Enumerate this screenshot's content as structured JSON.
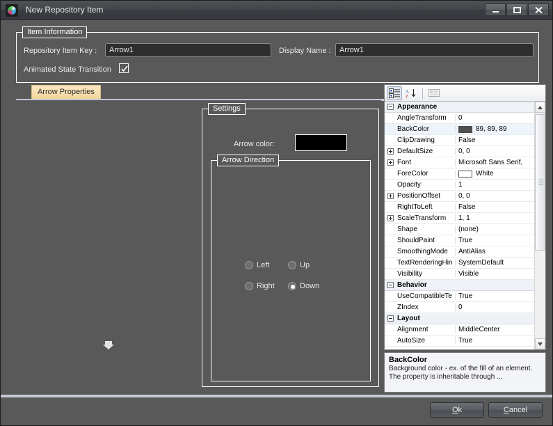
{
  "window": {
    "title": "New Repository Item",
    "app_icon": "color-orb-icon",
    "controls": {
      "minimize": "minimize-icon",
      "maximize": "maximize-icon",
      "close": "close-icon"
    }
  },
  "item_information": {
    "group_title": "Item Information",
    "repository_item_key": {
      "label": "Repository Item Key :",
      "value": "Arrow1"
    },
    "display_name": {
      "label": "Display Name :",
      "value": "Arrow1"
    },
    "animated_state_transition": {
      "label": "Animated State Transition",
      "checked": true
    }
  },
  "tabs": [
    {
      "label": "Arrow Properties",
      "active": true
    }
  ],
  "settings": {
    "group_title": "Settings",
    "arrow_color": {
      "label": "Arrow color:",
      "value": "#000000"
    },
    "arrow_direction": {
      "group_title": "Arrow Direction",
      "options": [
        {
          "label": "Left",
          "checked": false
        },
        {
          "label": "Up",
          "checked": false
        },
        {
          "label": "Right",
          "checked": false
        },
        {
          "label": "Down",
          "checked": true
        }
      ]
    },
    "preview_icon": "arrow-down-icon"
  },
  "property_grid": {
    "toolbar": [
      {
        "name": "categorized-view-button",
        "active": true
      },
      {
        "name": "alphabetical-sort-button",
        "active": false
      },
      {
        "name": "property-pages-button",
        "active": false,
        "disabled": true
      }
    ],
    "rows": [
      {
        "kind": "category",
        "name": "Appearance",
        "expander": "minus"
      },
      {
        "kind": "prop",
        "name": "AngleTransform",
        "value": "0"
      },
      {
        "kind": "prop",
        "name": "BackColor",
        "value": "89, 89, 89",
        "swatch": "#4f4f4f",
        "selected": true
      },
      {
        "kind": "prop",
        "name": "ClipDrawing",
        "value": "False"
      },
      {
        "kind": "prop",
        "name": "DefaultSize",
        "value": "0, 0",
        "expander": "plus"
      },
      {
        "kind": "prop",
        "name": "Font",
        "value": "Microsoft Sans Serif, ",
        "expander": "plus"
      },
      {
        "kind": "prop",
        "name": "ForeColor",
        "value": "White",
        "swatch": "#ffffff"
      },
      {
        "kind": "prop",
        "name": "Opacity",
        "value": "1"
      },
      {
        "kind": "prop",
        "name": "PositionOffset",
        "value": "0, 0",
        "expander": "plus"
      },
      {
        "kind": "prop",
        "name": "RightToLeft",
        "value": "False"
      },
      {
        "kind": "prop",
        "name": "ScaleTransform",
        "value": "1, 1",
        "expander": "plus"
      },
      {
        "kind": "prop",
        "name": "Shape",
        "value": "(none)"
      },
      {
        "kind": "prop",
        "name": "ShouldPaint",
        "value": "True"
      },
      {
        "kind": "prop",
        "name": "SmoothingMode",
        "value": "AntiAlias"
      },
      {
        "kind": "prop",
        "name": "TextRenderingHin",
        "value": "SystemDefault"
      },
      {
        "kind": "prop",
        "name": "Visibility",
        "value": "Visible"
      },
      {
        "kind": "category",
        "name": "Behavior",
        "expander": "minus"
      },
      {
        "kind": "prop",
        "name": "UseCompatibleTe",
        "value": "True"
      },
      {
        "kind": "prop",
        "name": "ZIndex",
        "value": "0"
      },
      {
        "kind": "category",
        "name": "Layout",
        "expander": "minus"
      },
      {
        "kind": "prop",
        "name": "Alignment",
        "value": "MiddleCenter"
      },
      {
        "kind": "prop",
        "name": "AutoSize",
        "value": "True"
      }
    ],
    "description": {
      "title": "BackColor",
      "body": "Background color - ex. of the fill of an element. The property is inheritable through ..."
    }
  },
  "footer": {
    "ok": {
      "mnemonic": "O",
      "rest": "k"
    },
    "cancel": {
      "mnemonic": "C",
      "rest": "ancel"
    }
  }
}
